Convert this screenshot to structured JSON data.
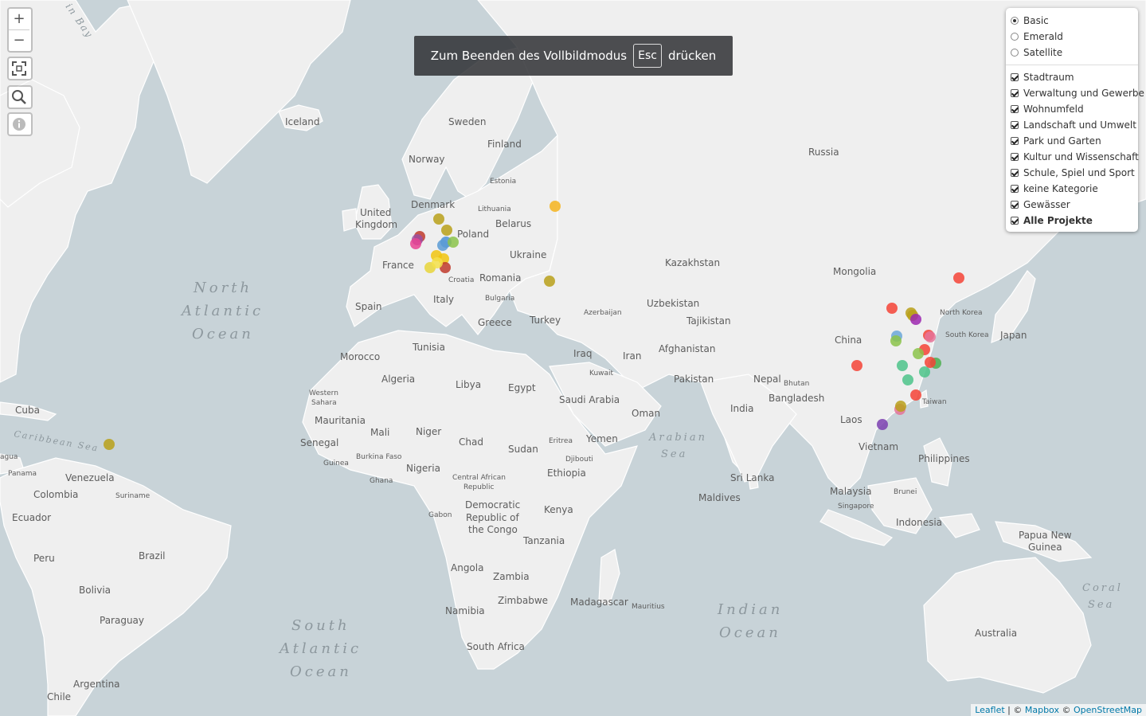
{
  "map": {
    "labels": {
      "countries": [
        "Iceland",
        "Sweden",
        "Finland",
        "Norway",
        "Russia",
        "Estonia",
        "Denmark",
        "Lithuania",
        "United",
        "Kingdom",
        "Belarus",
        "Poland",
        "Ukraine",
        "France",
        "Kazakhstan",
        "Mongolia",
        "Croatia",
        "Romania",
        "Italy",
        "Bulgaria",
        "Spain",
        "Greece",
        "Turkey",
        "Azerbaijan",
        "Uzbekistan",
        "Tajikistan",
        "China",
        "North Korea",
        "South Korea",
        "Japan",
        "Tunisia",
        "Morocco",
        "Iraq",
        "Iran",
        "Afghanistan",
        "Algeria",
        "Libya",
        "Egypt",
        "Kuwait",
        "Pakistan",
        "Nepal",
        "Bhutan",
        "Western",
        "Sahara",
        "Saudi Arabia",
        "Bangladesh",
        "Oman",
        "Cuba",
        "Mauritania",
        "India",
        "Taiwan",
        "Laos",
        "Senegal",
        "Mali",
        "Niger",
        "Chad",
        "Sudan",
        "Eritrea",
        "Yemen",
        "Vietnam",
        "Philippines",
        "Burkina Faso",
        "Guinea",
        "Djibouti",
        "Ghana",
        "Nigeria",
        "Central African",
        "Republic",
        "Ethiopia",
        "Sri Lanka",
        "Venezuela",
        "Colombia",
        "Suriname",
        "Ecuador",
        "Panama",
        "Democratic",
        "Republic of",
        "the Congo",
        "Gabon",
        "Kenya",
        "Maldives",
        "Malaysia",
        "Brunei",
        "Singapore",
        "Indonesia",
        "Papua New",
        "Guinea",
        "Tanzania",
        "Peru",
        "Brazil",
        "Bolivia",
        "Angola",
        "Zambia",
        "Zimbabwe",
        "Madagascar",
        "Mauritius",
        "Namibia",
        "Paraguay",
        "South Africa",
        "Argentina",
        "Chile",
        "Australia",
        "agua"
      ],
      "oceans": {
        "north_atlantic": [
          "North",
          "Atlantic",
          "Ocean"
        ],
        "south_atlantic": [
          "South",
          "Atlantic",
          "Ocean"
        ],
        "indian": [
          "Indian",
          "Ocean"
        ],
        "arabian": [
          "Arabian",
          "Sea"
        ],
        "caribbean": "Caribbean Sea",
        "coral": [
          "Coral",
          "Sea"
        ],
        "bay": "in Bay"
      }
    },
    "markers": [
      {
        "color": "#b8a01a"
      },
      {
        "color": "#b8a01a"
      },
      {
        "color": "#c0392b"
      },
      {
        "color": "#9b4fa0"
      },
      {
        "color": "#e84393"
      },
      {
        "color": "#4a90d9"
      },
      {
        "color": "#5b9bd5"
      },
      {
        "color": "#f1c40f"
      },
      {
        "color": "#f1c40f"
      },
      {
        "color": "#e8d53a"
      },
      {
        "color": "#c0392b"
      },
      {
        "color": "#f5e14a"
      },
      {
        "color": "#8bc34a"
      },
      {
        "color": "#b8a01a"
      },
      {
        "color": "#f5b41e"
      },
      {
        "color": "#b8a01a"
      },
      {
        "color": "#b8a01a"
      },
      {
        "color": "#f44336"
      },
      {
        "color": "#f44336"
      },
      {
        "color": "#f44336"
      },
      {
        "color": "#b8a01a"
      },
      {
        "color": "#9c27b0"
      },
      {
        "color": "#6aa7d8"
      },
      {
        "color": "#8bc34a"
      },
      {
        "color": "#e57399"
      },
      {
        "color": "#f44336"
      },
      {
        "color": "#8bc34a"
      },
      {
        "color": "#f44336"
      },
      {
        "color": "#4caf50"
      },
      {
        "color": "#4cc38a"
      },
      {
        "color": "#4cc38a"
      },
      {
        "color": "#4cc38a"
      },
      {
        "color": "#f44336"
      },
      {
        "color": "#f44336"
      },
      {
        "color": "#e57399"
      },
      {
        "color": "#b8a01a"
      },
      {
        "color": "#7b3fb0"
      }
    ]
  },
  "controls": {
    "zoom_in": "+",
    "zoom_out": "−"
  },
  "fullscreen_banner": {
    "before": "Zum Beenden des Vollbildmodus",
    "key": "Esc",
    "after": "drücken"
  },
  "layers": {
    "base": [
      {
        "label": "Basic",
        "selected": true
      },
      {
        "label": "Emerald",
        "selected": false
      },
      {
        "label": "Satellite",
        "selected": false
      }
    ],
    "overlays": [
      {
        "label": "Stadtraum",
        "checked": true
      },
      {
        "label": "Verwaltung und Gewerbe",
        "checked": true
      },
      {
        "label": "Wohnumfeld",
        "checked": true
      },
      {
        "label": "Landschaft und Umwelt",
        "checked": true
      },
      {
        "label": "Park und Garten",
        "checked": true
      },
      {
        "label": "Kultur und Wissenschaft",
        "checked": true
      },
      {
        "label": "Schule, Spiel und Sport",
        "checked": true
      },
      {
        "label": "keine Kategorie",
        "checked": true
      },
      {
        "label": "Gewässer",
        "checked": true
      },
      {
        "label": "Alle Projekte",
        "checked": true
      }
    ]
  },
  "attribution": {
    "leaflet": "Leaflet",
    "sep1": " | © ",
    "mapbox": "Mapbox",
    "sep2": " © ",
    "osm": "OpenStreetMap"
  }
}
